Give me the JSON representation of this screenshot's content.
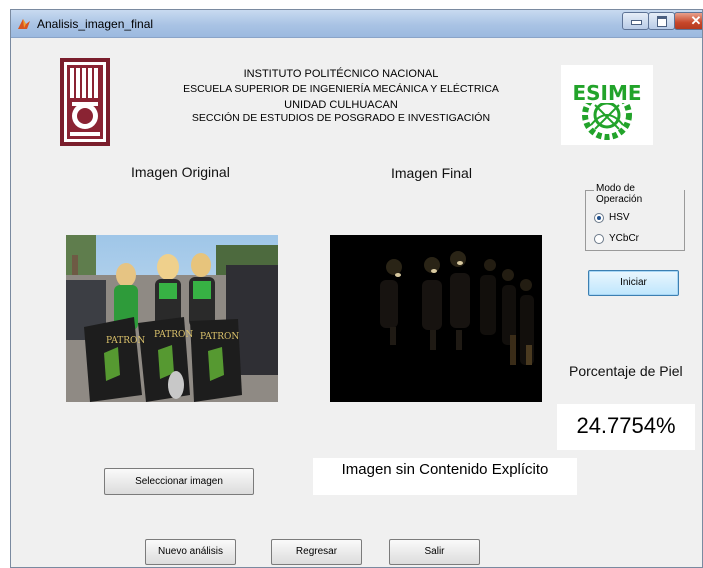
{
  "window": {
    "title": "Analisis_imagen_final"
  },
  "header": {
    "line1": "INSTITUTO POLITÉCNICO NACIONAL",
    "line2": "ESCUELA SUPERIOR DE INGENIERÍA MECÁNICA Y ELÉCTRICA",
    "line3": "UNIDAD CULHUACAN",
    "line4": "SECCIÓN DE ESTUDIOS DE POSGRADO E INVESTIGACIÓN"
  },
  "logos": {
    "left_text": "IPN",
    "right_text": "ESIME"
  },
  "labels": {
    "original": "Imagen Original",
    "final": "Imagen Final",
    "skin_percent": "Porcentaje de Piel"
  },
  "mode_panel": {
    "title": "Modo de Operación",
    "options": [
      {
        "label": "HSV",
        "selected": true
      },
      {
        "label": "YCbCr",
        "selected": false
      }
    ]
  },
  "buttons": {
    "start": "Iniciar",
    "select_image": "Seleccionar imagen",
    "new_analysis": "Nuevo análisis",
    "back": "Regresar",
    "exit": "Salir"
  },
  "result": {
    "percentage": "24.7754%",
    "message": "Imagen sin Contenido Explícito"
  },
  "photo_text": {
    "brand": "PATRON"
  },
  "colors": {
    "accent_green": "#22a32a",
    "ipn_maroon": "#7a1e2c",
    "button_focus": "#3c7fb1"
  }
}
